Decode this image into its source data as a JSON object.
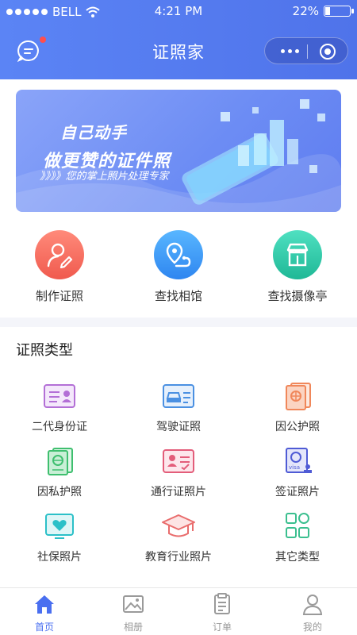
{
  "status_bar": {
    "carrier": "BELL",
    "time": "4:21 PM",
    "battery": "22%",
    "battery_level": 0.22
  },
  "header": {
    "title": "证照家"
  },
  "banner": {
    "line1": "自己动手",
    "line2": "做更赞的证件照",
    "line3": "》》》》您的掌上照片处理专家"
  },
  "quick_actions": [
    {
      "label": "制作证照",
      "icon": "person-edit-icon"
    },
    {
      "label": "查找相馆",
      "icon": "map-pin-icon"
    },
    {
      "label": "查找摄像亭",
      "icon": "kiosk-icon"
    }
  ],
  "section": {
    "title": "证照类型"
  },
  "types": [
    {
      "label": "二代身份证",
      "icon": "id-card-icon",
      "color": "#b36fd6"
    },
    {
      "label": "驾驶证照",
      "icon": "driver-license-icon",
      "color": "#4a90e2"
    },
    {
      "label": "因公护照",
      "icon": "official-passport-icon",
      "color": "#f0875a"
    },
    {
      "label": "因私护照",
      "icon": "private-passport-icon",
      "color": "#3fbf6f"
    },
    {
      "label": "通行证照片",
      "icon": "pass-card-icon",
      "color": "#e35d7a"
    },
    {
      "label": "签证照片",
      "icon": "visa-icon",
      "color": "#4f5bd5"
    },
    {
      "label": "社保照片",
      "icon": "social-security-icon",
      "color": "#2cc0c8"
    },
    {
      "label": "教育行业照片",
      "icon": "graduation-cap-icon",
      "color": "#e96d6d"
    },
    {
      "label": "其它类型",
      "icon": "grid-more-icon",
      "color": "#3bbf8f"
    }
  ],
  "tabbar": {
    "items": [
      {
        "label": "首页",
        "icon": "home-icon",
        "active": true
      },
      {
        "label": "相册",
        "icon": "album-icon",
        "active": false
      },
      {
        "label": "订单",
        "icon": "order-icon",
        "active": false
      },
      {
        "label": "我的",
        "icon": "profile-icon",
        "active": false
      }
    ]
  },
  "colors": {
    "primary": "#4f73ea",
    "tab_active": "#4a6ff0",
    "tab_inactive": "#9a9a9a"
  }
}
